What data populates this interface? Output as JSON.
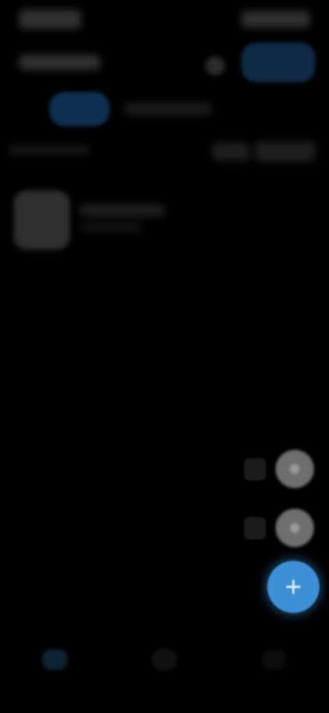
{
  "colors": {
    "background": "#000000",
    "accent": "#3d8fd6",
    "accent_dim": "#0f2a45"
  },
  "status_bar": {
    "time_icon": "clock-blob",
    "system_icons": "status-icons"
  },
  "header": {
    "action_icon": "pill-button"
  },
  "speed_dial": {
    "items": [
      {
        "label": "",
        "icon": "circle-icon"
      },
      {
        "label": "",
        "icon": "circle-icon"
      }
    ],
    "main": {
      "label": "",
      "icon": "plus-icon"
    }
  },
  "bottom_nav": {
    "items": [
      {
        "label": "",
        "icon": "home-icon",
        "active": true
      },
      {
        "label": "",
        "icon": "list-icon",
        "active": false
      },
      {
        "label": "",
        "icon": "more-icon",
        "active": false
      }
    ]
  }
}
